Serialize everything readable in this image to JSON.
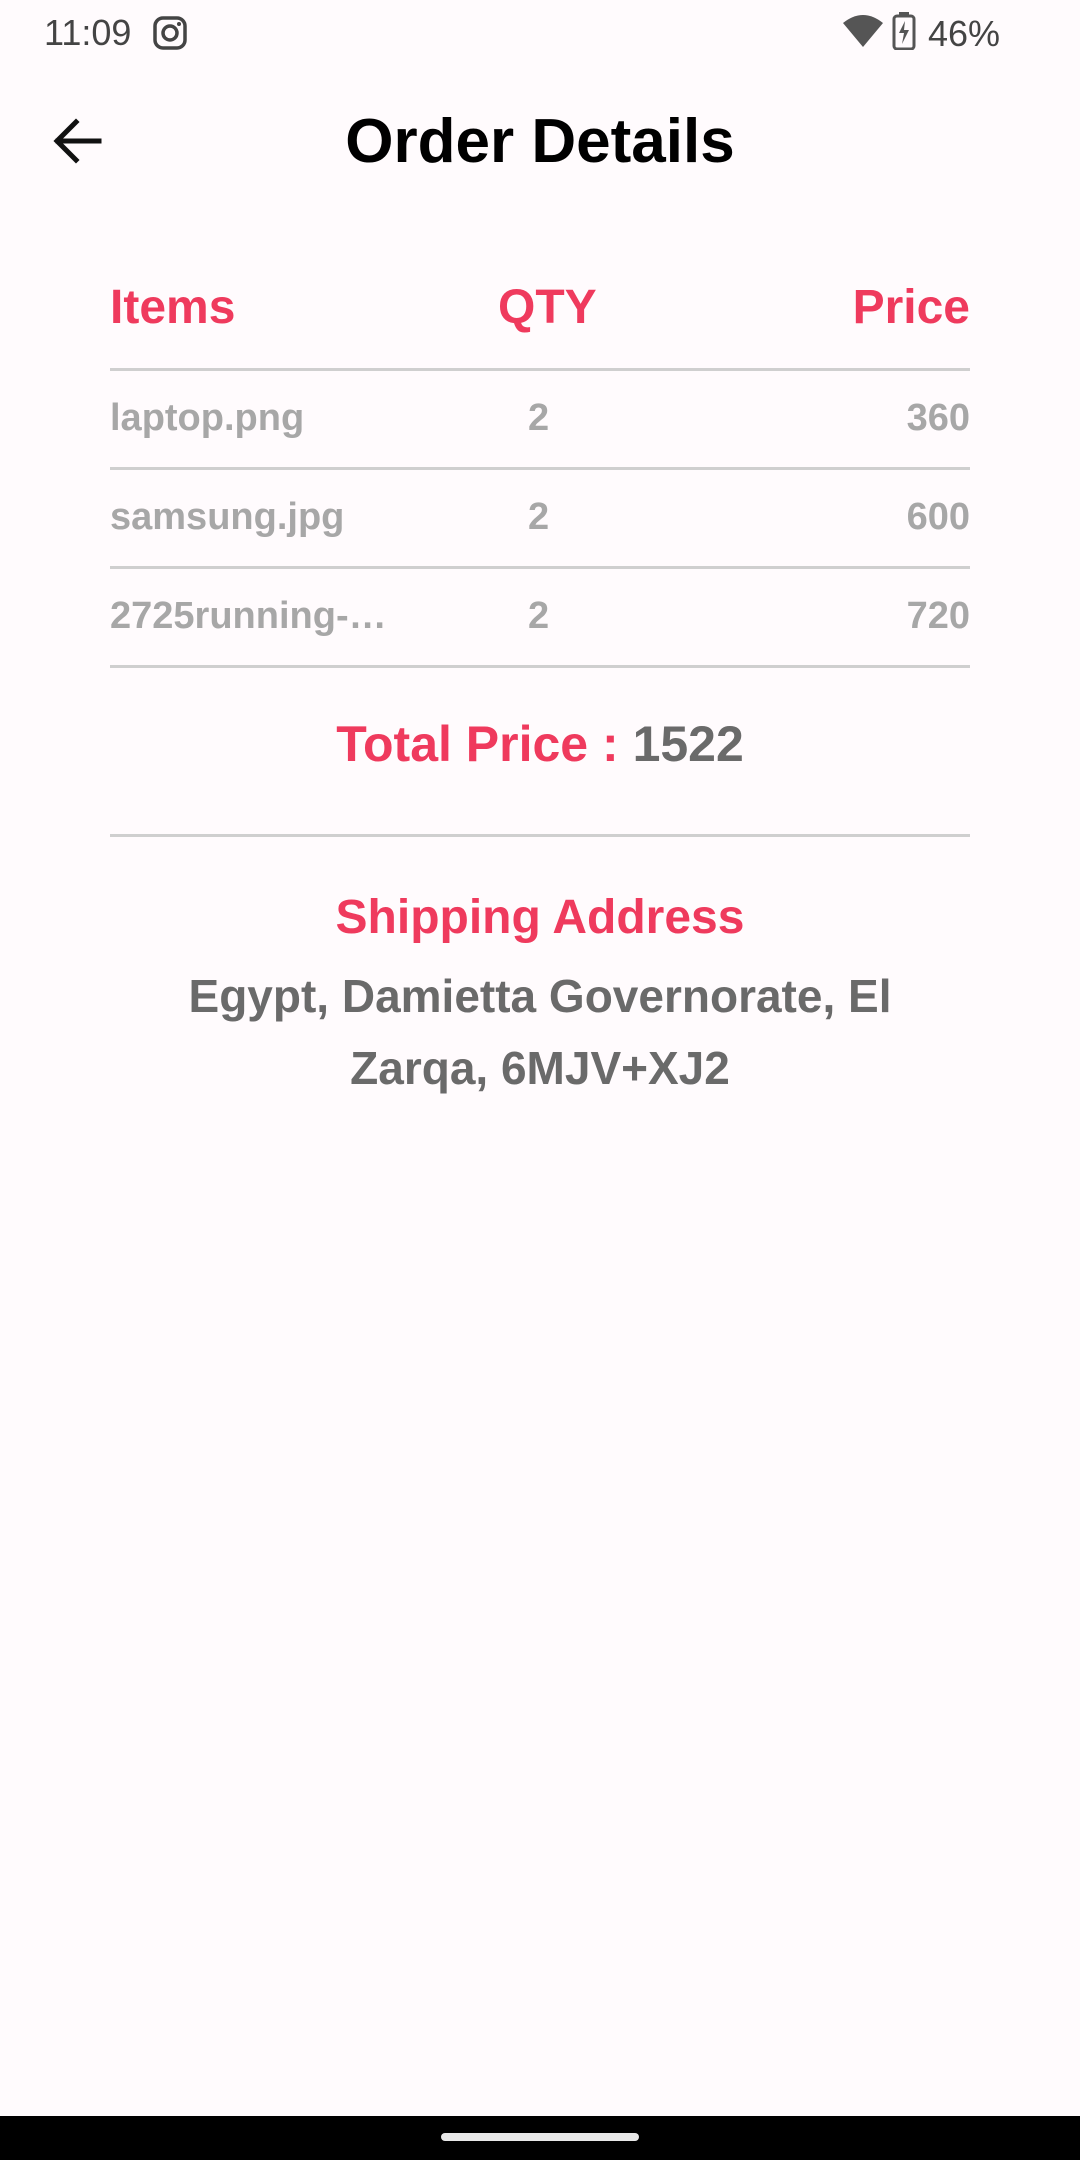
{
  "status_bar": {
    "time": "11:09",
    "battery": "46%",
    "icons": [
      "instagram-icon",
      "wifi-icon",
      "battery-charging-icon"
    ]
  },
  "header": {
    "title": "Order Details",
    "back_icon": "arrow-left-icon"
  },
  "table": {
    "columns": [
      "Items",
      "QTY",
      "Price"
    ],
    "rows": [
      {
        "item": "laptop.png",
        "qty": "2",
        "price": "360"
      },
      {
        "item": "samsung.jpg",
        "qty": "2",
        "price": "600"
      },
      {
        "item": "2725running-…",
        "qty": "2",
        "price": "720"
      }
    ]
  },
  "total": {
    "label": "Total Price : ",
    "value": "1522"
  },
  "shipping": {
    "title": "Shipping Address",
    "address": "Egypt, Damietta Governorate, El Zarqa, 6MJV+XJ2"
  },
  "colors": {
    "accent": "#ef3a5d",
    "muted_text": "#a7a7a7",
    "value_text": "#6a6a6a",
    "background": "#fffbfd"
  }
}
